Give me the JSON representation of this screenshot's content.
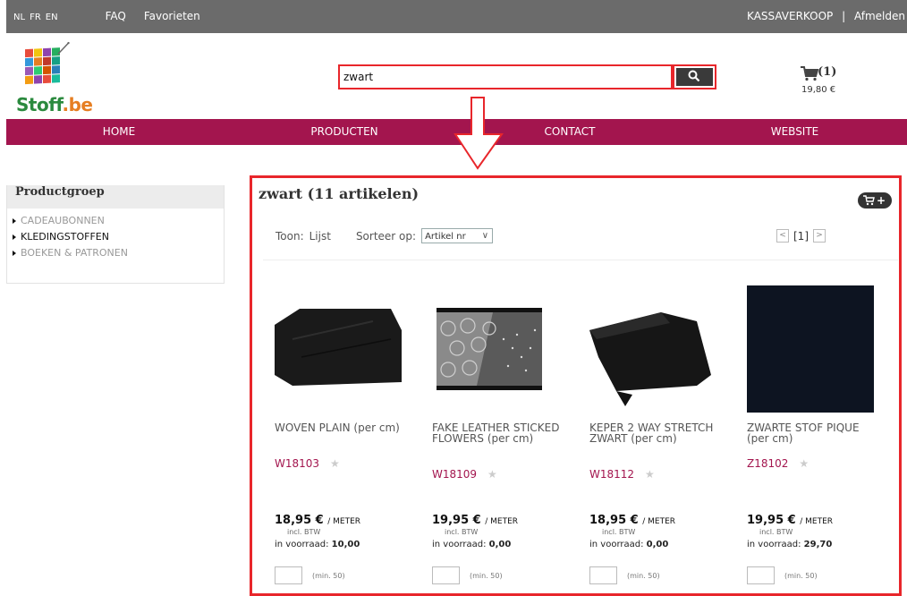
{
  "topbar": {
    "languages": [
      "NL",
      "FR",
      "EN"
    ],
    "faq": "FAQ",
    "favorites": "Favorieten",
    "account": "KASSAVERKOOP",
    "separator": "|",
    "logout": "Afmelden"
  },
  "logo": {
    "text_main": "Stoff",
    "text_suffix": ".be"
  },
  "search": {
    "value": "zwart"
  },
  "cart": {
    "count": "(1)",
    "total": "19,80 €"
  },
  "nav": [
    "HOME",
    "PRODUCTEN",
    "CONTACT",
    "WEBSITE"
  ],
  "sidebar": {
    "title": "Productgroep",
    "items": [
      {
        "label": "CADEAUBONNEN",
        "active": false
      },
      {
        "label": "KLEDINGSTOFFEN",
        "active": true
      },
      {
        "label": "BOEKEN & PATRONEN",
        "active": false
      }
    ]
  },
  "results": {
    "title": "zwart (11 artikelen)",
    "view_label": "Toon:",
    "view_value": "Lijst",
    "sort_label": "Sorteer op:",
    "sort_value": "Artikel nr",
    "page": "[1]"
  },
  "products": [
    {
      "name": "WOVEN PLAIN (per cm)",
      "code": "W18103",
      "price": "18,95 €",
      "unit": "/ METER",
      "vat": "incl. BTW",
      "stock_label": "in voorraad:",
      "stock": "10,00",
      "min": "(min. 50)"
    },
    {
      "name": "FAKE LEATHER STICKED FLOWERS (per cm)",
      "code": "W18109",
      "price": "19,95 €",
      "unit": "/ METER",
      "vat": "incl. BTW",
      "stock_label": "in voorraad:",
      "stock": "0,00",
      "min": "(min. 50)"
    },
    {
      "name": "KEPER 2 WAY STRETCH ZWART (per cm)",
      "code": "W18112",
      "price": "18,95 €",
      "unit": "/ METER",
      "vat": "incl. BTW",
      "stock_label": "in voorraad:",
      "stock": "0,00",
      "min": "(min. 50)"
    },
    {
      "name": "ZWARTE STOF PIQUE (per cm)",
      "code": "Z18102",
      "price": "19,95 €",
      "unit": "/ METER",
      "vat": "incl. BTW",
      "stock_label": "in voorraad:",
      "stock": "29,70",
      "min": "(min. 50)"
    }
  ],
  "colors": {
    "brand": "#a3154e",
    "highlight": "#e8262b",
    "topbar": "#6b6b6b"
  }
}
